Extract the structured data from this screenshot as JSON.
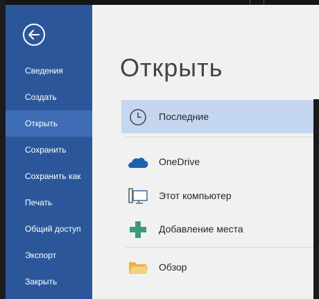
{
  "backstage": {
    "title": "Открыть",
    "back_icon": "back-arrow-icon"
  },
  "sidebar": {
    "items": [
      {
        "label": "Сведения"
      },
      {
        "label": "Создать"
      },
      {
        "label": "Открыть",
        "active": true
      },
      {
        "label": "Сохранить"
      },
      {
        "label": "Сохранить как"
      },
      {
        "label": "Печать"
      },
      {
        "label": "Общий доступ"
      },
      {
        "label": "Экспорт"
      },
      {
        "label": "Закрыть"
      }
    ]
  },
  "places": [
    {
      "label": "Последние",
      "icon": "clock-icon",
      "selected": true
    },
    {
      "label": "OneDrive",
      "icon": "cloud-icon"
    },
    {
      "label": "Этот компьютер",
      "icon": "computer-icon"
    },
    {
      "label": "Добавление места",
      "icon": "plus-icon"
    },
    {
      "label": "Обзор",
      "icon": "folder-icon"
    }
  ],
  "colors": {
    "sidebar": "#2b579a",
    "sidebar_active": "#3e6db5",
    "main_bg": "#f1f1f1",
    "selected_place": "#c5d7f0",
    "onedrive_blue": "#1e5fae",
    "plus_green": "#3f9a77",
    "folder_yellow": "#f2c15b"
  }
}
